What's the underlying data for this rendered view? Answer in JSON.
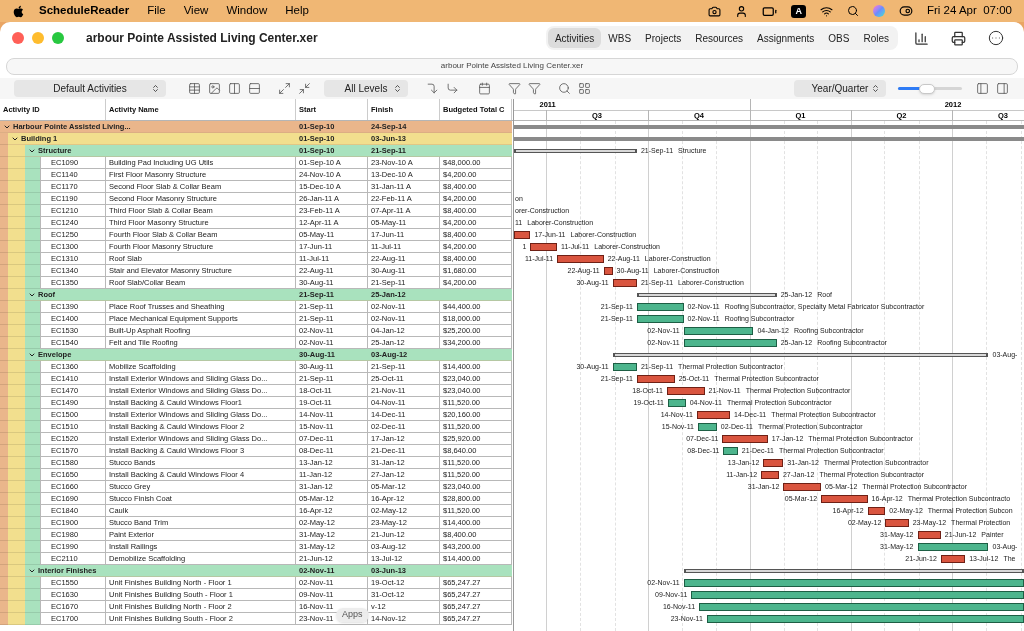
{
  "menu_bar": {
    "app": "ScheduleReader",
    "menus": [
      "File",
      "View",
      "Window",
      "Help"
    ],
    "input_source": "A",
    "clock": "Fri 24 Apr  07:00"
  },
  "window": {
    "title": "arbour Pointe Assisted Living Center.xer",
    "path": "arbour Pointe Assisted Living Center.xer"
  },
  "tabs": [
    {
      "label": "Activities",
      "selected": true
    },
    {
      "label": "WBS",
      "selected": false
    },
    {
      "label": "Projects",
      "selected": false
    },
    {
      "label": "Resources",
      "selected": false
    },
    {
      "label": "Assignments",
      "selected": false
    },
    {
      "label": "OBS",
      "selected": false
    },
    {
      "label": "Roles",
      "selected": false
    }
  ],
  "toolbar": {
    "layout": "Default Activities",
    "levels": "All Levels",
    "timescale": "Year/Quarter",
    "zoom": {
      "level": 0.45
    }
  },
  "table": {
    "columns": [
      "Activity ID",
      "Activity Name",
      "Start",
      "Finish",
      "Budgeted Total C"
    ],
    "rows": [
      {
        "kind": "project",
        "name": "Harbour Pointe Assisted Living...",
        "start": "01-Sep-10",
        "finish": "24-Sep-14",
        "expanded": true,
        "children": [
          {
            "kind": "building",
            "name": "Building 1",
            "start": "01-Sep-10",
            "finish": "03-Jun-13",
            "expanded": true,
            "children": [
              {
                "kind": "group",
                "name": "Structure",
                "start": "01-Sep-10",
                "finish": "21-Sep-11",
                "expanded": true,
                "bar_finish_label": "21-Sep-11",
                "bar_title": "Structure",
                "children": [
                  {
                    "kind": "activity",
                    "id": "EC1090",
                    "name": "Building Pad Including UG Utils",
                    "start": "01-Sep-10 A",
                    "finish": "23-Nov-10 A",
                    "budget": "$48,000.00"
                  },
                  {
                    "kind": "activity",
                    "id": "EC1140",
                    "name": "First Floor Masonry Structure",
                    "start": "24-Nov-10 A",
                    "finish": "13-Dec-10 A",
                    "budget": "$4,200.00"
                  },
                  {
                    "kind": "activity",
                    "id": "EC1170",
                    "name": "Second Floor Slab & Collar Beam",
                    "start": "15-Dec-10 A",
                    "finish": "31-Jan-11 A",
                    "budget": "$8,400.00"
                  },
                  {
                    "kind": "activity",
                    "id": "EC1190",
                    "name": "Second Floor Masonry Structure",
                    "start": "26-Jan-11 A",
                    "finish": "22-Feb-11 A",
                    "budget": "$4,200.00",
                    "bar_resource": "on"
                  },
                  {
                    "kind": "activity",
                    "id": "EC1210",
                    "name": "Third Floor Slab & Collar Beam",
                    "start": "23-Feb-11 A",
                    "finish": "07-Apr-11 A",
                    "budget": "$8,400.00",
                    "bar_resource": "orer-Construction"
                  },
                  {
                    "kind": "activity",
                    "id": "EC1240",
                    "name": "Third Floor Masonry Structure",
                    "start": "12-Apr-11 A",
                    "finish": "05-May-11",
                    "budget": "$4,200.00",
                    "bar_finish_label": "11",
                    "bar_resource": "Laborer-Construction"
                  },
                  {
                    "kind": "activity",
                    "id": "EC1250",
                    "name": "Fourth Floor Slab & Collar Beam",
                    "start": "05-May-11",
                    "finish": "17-Jun-11",
                    "budget": "$8,400.00",
                    "critical": true,
                    "bar_finish_label": "17-Jun-11",
                    "bar_resource": "Laborer-Construction"
                  },
                  {
                    "kind": "activity",
                    "id": "EC1300",
                    "name": "Fourth Floor Masonry Structure",
                    "start": "17-Jun-11",
                    "finish": "11-Jul-11",
                    "budget": "$4,200.00",
                    "critical": true,
                    "bar_start_label": "1",
                    "bar_finish_label": "11-Jul-11",
                    "bar_resource": "Laborer-Construction"
                  },
                  {
                    "kind": "activity",
                    "id": "EC1310",
                    "name": "Roof Slab",
                    "start": "11-Jul-11",
                    "finish": "22-Aug-11",
                    "budget": "$8,400.00",
                    "critical": true,
                    "bar_start_label": "11-Jul-11",
                    "bar_finish_label": "22-Aug-11",
                    "bar_resource": "Laborer-Construction"
                  },
                  {
                    "kind": "activity",
                    "id": "EC1340",
                    "name": "Stair and Elevator Masonry Structure",
                    "start": "22-Aug-11",
                    "finish": "30-Aug-11",
                    "budget": "$1,680.00",
                    "critical": true,
                    "bar_start_label": "22-Aug-11",
                    "bar_finish_label": "30-Aug-11",
                    "bar_resource": "Laborer-Construction"
                  },
                  {
                    "kind": "activity",
                    "id": "EC1350",
                    "name": "Roof Slab/Collar Beam",
                    "start": "30-Aug-11",
                    "finish": "21-Sep-11",
                    "budget": "$4,200.00",
                    "critical": true,
                    "bar_start_label": "30-Aug-11",
                    "bar_finish_label": "21-Sep-11",
                    "bar_resource": "Laborer-Construction"
                  }
                ]
              },
              {
                "kind": "group",
                "name": "Roof",
                "start": "21-Sep-11",
                "finish": "25-Jan-12",
                "expanded": true,
                "bar_finish_label": "25-Jan-12",
                "bar_title": "Roof",
                "children": [
                  {
                    "kind": "activity",
                    "id": "EC1390",
                    "name": "Place Roof Trusses and Sheathing",
                    "start": "21-Sep-11",
                    "finish": "02-Nov-11",
                    "budget": "$44,400.00",
                    "critical": false,
                    "bar_start_label": "21-Sep-11",
                    "bar_finish_label": "02-Nov-11",
                    "bar_resource": "Roofing Subcontractor, Specialty Metal Fabricator Subcontractor"
                  },
                  {
                    "kind": "activity",
                    "id": "EC1400",
                    "name": "Place Mechanical Equipment Supports",
                    "start": "21-Sep-11",
                    "finish": "02-Nov-11",
                    "budget": "$18,000.00",
                    "critical": false,
                    "bar_start_label": "21-Sep-11",
                    "bar_finish_label": "02-Nov-11",
                    "bar_resource": "Roofing Subcontractor"
                  },
                  {
                    "kind": "activity",
                    "id": "EC1530",
                    "name": "Built-Up Asphalt Roofing",
                    "start": "02-Nov-11",
                    "finish": "04-Jan-12",
                    "budget": "$25,200.00",
                    "critical": false,
                    "bar_start_label": "02-Nov-11",
                    "bar_finish_label": "04-Jan-12",
                    "bar_resource": "Roofing Subcontractor"
                  },
                  {
                    "kind": "activity",
                    "id": "EC1540",
                    "name": "Felt and Tile Roofing",
                    "start": "02-Nov-11",
                    "finish": "25-Jan-12",
                    "budget": "$34,200.00",
                    "critical": false,
                    "bar_start_label": "02-Nov-11",
                    "bar_finish_label": "25-Jan-12",
                    "bar_resource": "Roofing Subcontractor"
                  }
                ]
              },
              {
                "kind": "group",
                "name": "Envelope",
                "start": "30-Aug-11",
                "finish": "03-Aug-12",
                "expanded": true,
                "bar_finish_label": "03-Aug-",
                "children": [
                  {
                    "kind": "activity",
                    "id": "EC1360",
                    "name": "Mobilize Scaffolding",
                    "start": "30-Aug-11",
                    "finish": "21-Sep-11",
                    "budget": "$14,400.00",
                    "critical": false,
                    "bar_start_label": "30-Aug-11",
                    "bar_finish_label": "21-Sep-11",
                    "bar_resource": "Thermal Protection Subcontractor"
                  },
                  {
                    "kind": "activity",
                    "id": "EC1410",
                    "name": "Install Exterior Windows and Sliding Glass Do...",
                    "start": "21-Sep-11",
                    "finish": "25-Oct-11",
                    "budget": "$23,040.00",
                    "critical": true,
                    "bar_start_label": "21-Sep-11",
                    "bar_finish_label": "25-Oct-11",
                    "bar_resource": "Thermal Protection Subcontractor"
                  },
                  {
                    "kind": "activity",
                    "id": "EC1470",
                    "name": "Install Exterior Windows and Sliding Glass Do...",
                    "start": "18-Oct-11",
                    "finish": "21-Nov-11",
                    "budget": "$23,040.00",
                    "critical": true,
                    "bar_start_label": "18-Oct-11",
                    "bar_finish_label": "21-Nov-11",
                    "bar_resource": "Thermal Protection Subcontractor"
                  },
                  {
                    "kind": "activity",
                    "id": "EC1490",
                    "name": "Install Backing & Cauld Windows Floor1",
                    "start": "19-Oct-11",
                    "finish": "04-Nov-11",
                    "budget": "$11,520.00",
                    "critical": false,
                    "bar_start_label": "19-Oct-11",
                    "bar_finish_label": "04-Nov-11",
                    "bar_resource": "Thermal Protection Subcontractor"
                  },
                  {
                    "kind": "activity",
                    "id": "EC1500",
                    "name": "Install Exterior Windows and Sliding Glass Do...",
                    "start": "14-Nov-11",
                    "finish": "14-Dec-11",
                    "budget": "$20,160.00",
                    "critical": true,
                    "bar_start_label": "14-Nov-11",
                    "bar_finish_label": "14-Dec-11",
                    "bar_resource": "Thermal Protection Subcontractor"
                  },
                  {
                    "kind": "activity",
                    "id": "EC1510",
                    "name": "Install Backing & Cauld Windows Floor 2",
                    "start": "15-Nov-11",
                    "finish": "02-Dec-11",
                    "budget": "$11,520.00",
                    "critical": false,
                    "bar_start_label": "15-Nov-11",
                    "bar_finish_label": "02-Dec-11",
                    "bar_resource": "Thermal Protection Subcontractor"
                  },
                  {
                    "kind": "activity",
                    "id": "EC1520",
                    "name": "Install Exterior Windows and Sliding Glass Do...",
                    "start": "07-Dec-11",
                    "finish": "17-Jan-12",
                    "budget": "$25,920.00",
                    "critical": true,
                    "bar_start_label": "07-Dec-11",
                    "bar_finish_label": "17-Jan-12",
                    "bar_resource": "Thermal Protection Subcontractor"
                  },
                  {
                    "kind": "activity",
                    "id": "EC1570",
                    "name": "Install Backing & Cauld Windows Floor 3",
                    "start": "08-Dec-11",
                    "finish": "21-Dec-11",
                    "budget": "$8,640.00",
                    "critical": false,
                    "bar_start_label": "08-Dec-11",
                    "bar_finish_label": "21-Dec-11",
                    "bar_resource": "Thermal Protection Subcontractor"
                  },
                  {
                    "kind": "activity",
                    "id": "EC1580",
                    "name": "Stucco Bands",
                    "start": "13-Jan-12",
                    "finish": "31-Jan-12",
                    "budget": "$11,520.00",
                    "critical": true,
                    "bar_start_label": "13-Jan-12",
                    "bar_finish_label": "31-Jan-12",
                    "bar_resource": "Thermal Protection Subcontractor"
                  },
                  {
                    "kind": "activity",
                    "id": "EC1650",
                    "name": "Install Backing & Cauld Windows Floor 4",
                    "start": "11-Jan-12",
                    "finish": "27-Jan-12",
                    "budget": "$11,520.00",
                    "critical": true,
                    "bar_start_label": "11-Jan-12",
                    "bar_finish_label": "27-Jan-12",
                    "bar_resource": "Thermal Protection Subcontractor"
                  },
                  {
                    "kind": "activity",
                    "id": "EC1660",
                    "name": "Stucco Grey",
                    "start": "31-Jan-12",
                    "finish": "05-Mar-12",
                    "budget": "$23,040.00",
                    "critical": true,
                    "bar_start_label": "31-Jan-12",
                    "bar_finish_label": "05-Mar-12",
                    "bar_resource": "Thermal Protection Subcontractor"
                  },
                  {
                    "kind": "activity",
                    "id": "EC1690",
                    "name": "Stucco Finish Coat",
                    "start": "05-Mar-12",
                    "finish": "16-Apr-12",
                    "budget": "$28,800.00",
                    "critical": true,
                    "bar_start_label": "05-Mar-12",
                    "bar_finish_label": "16-Apr-12",
                    "bar_resource": "Thermal Protection Subcontracto"
                  },
                  {
                    "kind": "activity",
                    "id": "EC1840",
                    "name": "Caulk",
                    "start": "16-Apr-12",
                    "finish": "02-May-12",
                    "budget": "$11,520.00",
                    "critical": true,
                    "bar_start_label": "16-Apr-12",
                    "bar_finish_label": "02-May-12",
                    "bar_resource": "Thermal Protection Subcon"
                  },
                  {
                    "kind": "activity",
                    "id": "EC1900",
                    "name": "Stucco Band Trim",
                    "start": "02-May-12",
                    "finish": "23-May-12",
                    "budget": "$14,400.00",
                    "critical": true,
                    "bar_start_label": "02-May-12",
                    "bar_finish_label": "23-May-12",
                    "bar_resource": "Thermal Protection"
                  },
                  {
                    "kind": "activity",
                    "id": "EC1980",
                    "name": "Paint Exterior",
                    "start": "31-May-12",
                    "finish": "21-Jun-12",
                    "budget": "$8,400.00",
                    "critical": true,
                    "bar_start_label": "31-May-12",
                    "bar_finish_label": "21-Jun-12",
                    "bar_resource": "Painter"
                  },
                  {
                    "kind": "activity",
                    "id": "EC1990",
                    "name": "Install Railings",
                    "start": "31-May-12",
                    "finish": "03-Aug-12",
                    "budget": "$43,200.00",
                    "critical": false,
                    "bar_start_label": "31-May-12",
                    "bar_finish_label": "03-Aug-"
                  },
                  {
                    "kind": "activity",
                    "id": "EC2110",
                    "name": "Demobilize Scaffolding",
                    "start": "21-Jun-12",
                    "finish": "13-Jul-12",
                    "budget": "$14,400.00",
                    "critical": true,
                    "bar_start_label": "21-Jun-12",
                    "bar_finish_label": "13-Jul-12",
                    "bar_resource": "The"
                  }
                ]
              },
              {
                "kind": "group",
                "name": "Interior Finishes",
                "start": "02-Nov-11",
                "finish": "03-Jun-13",
                "expanded": true,
                "children": [
                  {
                    "kind": "activity",
                    "id": "EC1550",
                    "name": "Unit Finishes Building North - Floor 1",
                    "start": "02-Nov-11",
                    "finish": "19-Oct-12",
                    "budget": "$65,247.27",
                    "critical": false,
                    "bar_start_label": "02-Nov-11"
                  },
                  {
                    "kind": "activity",
                    "id": "EC1630",
                    "name": "Unit Finishes Building South - Floor 1",
                    "start": "09-Nov-11",
                    "finish": "31-Oct-12",
                    "budget": "$65,247.27",
                    "critical": false,
                    "bar_start_label": "09-Nov-11"
                  },
                  {
                    "kind": "activity",
                    "id": "EC1670",
                    "name": "Unit Finishes Building North - Floor 2",
                    "start": "16-Nov-11",
                    "finish": "v-12",
                    "budget": "$65,247.27",
                    "critical": false,
                    "bar_start_label": "16-Nov-11"
                  },
                  {
                    "kind": "activity",
                    "id": "EC1700",
                    "name": "Unit Finishes Building South - Floor 2",
                    "start": "23-Nov-11",
                    "finish": "14-Nov-12",
                    "budget": "$65,247.27",
                    "critical": false,
                    "bar_start_label": "23-Nov-11"
                  }
                ]
              }
            ]
          }
        ]
      }
    ]
  },
  "gantt": {
    "years": [
      "2011",
      "2012"
    ],
    "quarters": [
      "Q3",
      "Q4",
      "Q1",
      "Q2",
      "Q3"
    ]
  },
  "tooltip": "Apps"
}
